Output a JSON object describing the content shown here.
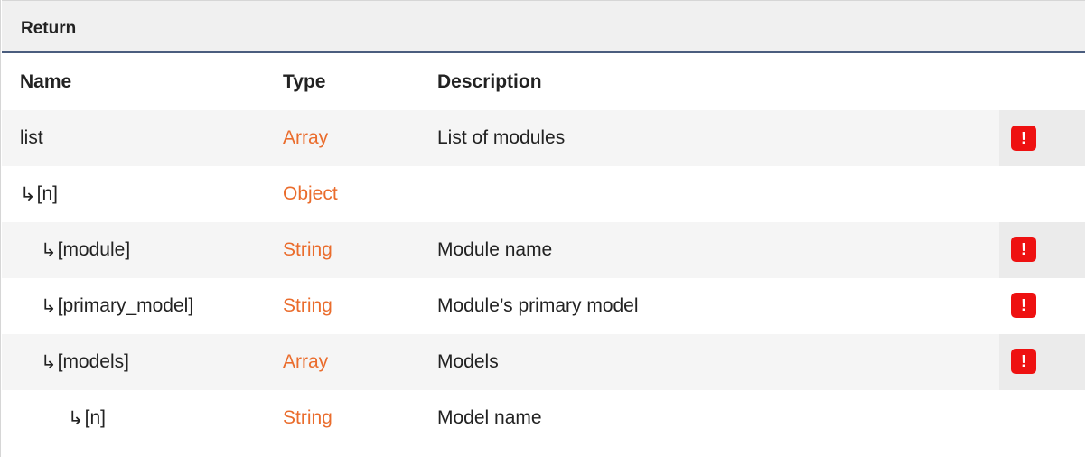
{
  "section": {
    "title": "Return"
  },
  "headers": {
    "name": "Name",
    "type": "Type",
    "description": "Description"
  },
  "rows": [
    {
      "name": "list",
      "type": "Array",
      "description": "List of modules",
      "required": true,
      "indent": 0,
      "arrow": ""
    },
    {
      "name": "[n]",
      "type": "Object",
      "description": "",
      "required": false,
      "indent": 0,
      "arrow": "↳"
    },
    {
      "name": "[module]",
      "type": "String",
      "description": "Module name",
      "required": true,
      "indent": 1,
      "arrow": "↳"
    },
    {
      "name": "[primary_model]",
      "type": "String",
      "description": "Module’s primary model",
      "required": true,
      "indent": 1,
      "arrow": "↳"
    },
    {
      "name": "[models]",
      "type": "Array",
      "description": "Models",
      "required": true,
      "indent": 1,
      "arrow": "↳"
    },
    {
      "name": "[n]",
      "type": "String",
      "description": "Model name",
      "required": false,
      "indent": 2,
      "arrow": "↳"
    }
  ],
  "required_badge": "!",
  "colors": {
    "type_text": "#ea6c2c",
    "badge": "#ee1111",
    "header_rule": "#4a5d7e"
  }
}
